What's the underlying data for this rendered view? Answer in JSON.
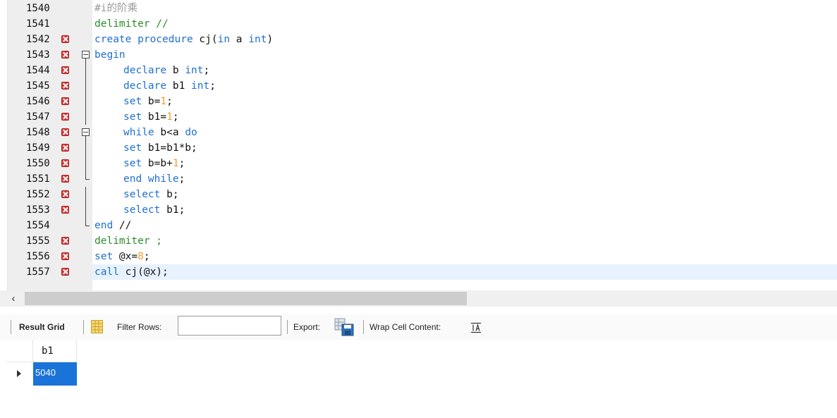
{
  "editor": {
    "lines": [
      {
        "num": "1540",
        "error": false,
        "indent": false,
        "fold": "none",
        "tokens": [
          {
            "t": "#i的阶乘",
            "c": "cmt"
          }
        ]
      },
      {
        "num": "1541",
        "error": false,
        "indent": false,
        "fold": "none",
        "tokens": [
          {
            "t": "delimiter //",
            "c": "del"
          }
        ]
      },
      {
        "num": "1542",
        "error": true,
        "indent": false,
        "fold": "none",
        "tokens": [
          {
            "t": "create procedure ",
            "c": "kw"
          },
          {
            "t": "cj(",
            "c": "id"
          },
          {
            "t": "in",
            "c": "kw"
          },
          {
            "t": " a ",
            "c": "id"
          },
          {
            "t": "int",
            "c": "kw"
          },
          {
            "t": ")",
            "c": "id"
          }
        ]
      },
      {
        "num": "1543",
        "error": true,
        "indent": false,
        "fold": "open",
        "tokens": [
          {
            "t": "begin",
            "c": "kw"
          }
        ]
      },
      {
        "num": "1544",
        "error": true,
        "indent": true,
        "fold": "line",
        "tokens": [
          {
            "t": "declare",
            "c": "kw"
          },
          {
            "t": " b ",
            "c": "id"
          },
          {
            "t": "int",
            "c": "kw"
          },
          {
            "t": ";",
            "c": "id"
          }
        ]
      },
      {
        "num": "1545",
        "error": true,
        "indent": true,
        "fold": "line",
        "tokens": [
          {
            "t": "declare",
            "c": "kw"
          },
          {
            "t": " b1 ",
            "c": "id"
          },
          {
            "t": "int",
            "c": "kw"
          },
          {
            "t": ";",
            "c": "id"
          }
        ]
      },
      {
        "num": "1546",
        "error": true,
        "indent": true,
        "fold": "line",
        "tokens": [
          {
            "t": "set",
            "c": "kw"
          },
          {
            "t": " b=",
            "c": "id"
          },
          {
            "t": "1",
            "c": "num"
          },
          {
            "t": ";",
            "c": "id"
          }
        ]
      },
      {
        "num": "1547",
        "error": true,
        "indent": true,
        "fold": "line",
        "tokens": [
          {
            "t": "set",
            "c": "kw"
          },
          {
            "t": " b1=",
            "c": "id"
          },
          {
            "t": "1",
            "c": "num"
          },
          {
            "t": ";",
            "c": "id"
          }
        ]
      },
      {
        "num": "1548",
        "error": true,
        "indent": true,
        "fold": "open",
        "tokens": [
          {
            "t": "while",
            "c": "kw"
          },
          {
            "t": " b<a ",
            "c": "id"
          },
          {
            "t": "do",
            "c": "kw"
          }
        ]
      },
      {
        "num": "1549",
        "error": true,
        "indent": true,
        "fold": "line",
        "tokens": [
          {
            "t": "set",
            "c": "kw"
          },
          {
            "t": " b1=b1*b;",
            "c": "id"
          }
        ]
      },
      {
        "num": "1550",
        "error": true,
        "indent": true,
        "fold": "line",
        "tokens": [
          {
            "t": "set",
            "c": "kw"
          },
          {
            "t": " b=b+",
            "c": "id"
          },
          {
            "t": "1",
            "c": "num"
          },
          {
            "t": ";",
            "c": "id"
          }
        ]
      },
      {
        "num": "1551",
        "error": true,
        "indent": true,
        "fold": "end",
        "tokens": [
          {
            "t": "end while",
            "c": "kw"
          },
          {
            "t": ";",
            "c": "id"
          }
        ]
      },
      {
        "num": "1552",
        "error": true,
        "indent": true,
        "fold": "line",
        "tokens": [
          {
            "t": "select",
            "c": "kw"
          },
          {
            "t": " b;",
            "c": "id"
          }
        ]
      },
      {
        "num": "1553",
        "error": true,
        "indent": true,
        "fold": "line",
        "tokens": [
          {
            "t": "select",
            "c": "kw"
          },
          {
            "t": " b1;",
            "c": "id"
          }
        ]
      },
      {
        "num": "1554",
        "error": false,
        "indent": false,
        "fold": "end",
        "tokens": [
          {
            "t": "end",
            "c": "kw"
          },
          {
            "t": " //",
            "c": "id"
          }
        ]
      },
      {
        "num": "1555",
        "error": true,
        "indent": false,
        "fold": "none",
        "tokens": [
          {
            "t": "delimiter ;",
            "c": "del"
          }
        ]
      },
      {
        "num": "1556",
        "error": true,
        "indent": false,
        "fold": "none",
        "tokens": [
          {
            "t": "set",
            "c": "kw"
          },
          {
            "t": " @x=",
            "c": "id"
          },
          {
            "t": "8",
            "c": "num"
          },
          {
            "t": ";",
            "c": "id"
          }
        ]
      },
      {
        "num": "1557",
        "error": true,
        "indent": false,
        "fold": "none",
        "current": true,
        "tokens": [
          {
            "t": "call",
            "c": "kw"
          },
          {
            "t": " cj(@x);",
            "c": "id"
          }
        ]
      }
    ]
  },
  "scrollbar": {
    "left_arrow": "‹"
  },
  "toolbar": {
    "result_grid_label": "Result Grid",
    "filter_rows_label": "Filter Rows:",
    "filter_value": "",
    "export_label": "Export:",
    "wrap_label": "Wrap Cell Content:",
    "grid_icon": "grid-icon",
    "export_icon": "export-icon",
    "wrap_icon": "wrap-cell-icon"
  },
  "result": {
    "columns": [
      "b1"
    ],
    "rows": [
      [
        "5040"
      ]
    ]
  },
  "colors": {
    "keyword": "#1f6fd1",
    "delimiter": "#2a8c2a",
    "number": "#f0a030",
    "comment": "#9a9a9a",
    "error_marker": "#d93a3a",
    "selection": "#1a73d9"
  }
}
